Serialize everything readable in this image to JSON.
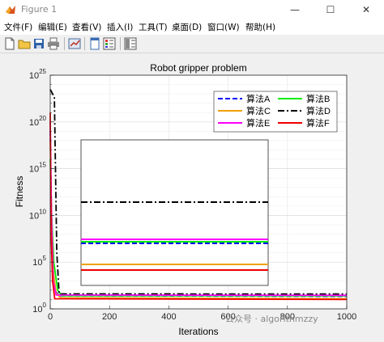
{
  "window": {
    "title": "Figure 1",
    "minimize": "—",
    "maximize": "☐",
    "close": "✕"
  },
  "menu": [
    "文件(F)",
    "编辑(E)",
    "查看(V)",
    "插入(I)",
    "工具(T)",
    "桌面(D)",
    "窗口(W)",
    "帮助(H)"
  ],
  "toolbar": [
    "new-figure-icon",
    "open-file-icon",
    "save-icon",
    "print-icon",
    "link-plot-icon",
    "dock-figure-icon",
    "insert-colorbar-icon",
    "insert-legend-icon"
  ],
  "watermark": "公众号 · algorithmzzy",
  "chart_data": {
    "type": "line",
    "title": "Robot gripper problem",
    "xlabel": "Iterations",
    "ylabel": "Fitness",
    "xlim": [
      0,
      1000
    ],
    "ylim": [
      1,
      1e+25
    ],
    "yscale": "log",
    "xticks": [
      "0",
      "200",
      "400",
      "600",
      "800",
      "1000"
    ],
    "yticks": [
      {
        "base": "10",
        "exp": "0",
        "v": 0
      },
      {
        "base": "10",
        "exp": "5",
        "v": 5
      },
      {
        "base": "10",
        "exp": "10",
        "v": 10
      },
      {
        "base": "10",
        "exp": "15",
        "v": 15
      },
      {
        "base": "10",
        "exp": "20",
        "v": 20
      },
      {
        "base": "10",
        "exp": "25",
        "v": 25
      }
    ],
    "grid": true,
    "legend_position": "top-right",
    "series": [
      {
        "name": "算法A",
        "color": "#0000ff",
        "dash": "6,3",
        "x": [
          0,
          3,
          8,
          15,
          30,
          1000
        ],
        "y": [
          1e+19,
          1000000000000.0,
          100000.0,
          100.0,
          25,
          22
        ]
      },
      {
        "name": "算法B",
        "color": "#00ee00",
        "dash": "",
        "x": [
          0,
          5,
          12,
          25,
          40,
          1000
        ],
        "y": [
          1e+16,
          10000000000.0,
          100000.0,
          100.0,
          25,
          24
        ]
      },
      {
        "name": "算法C",
        "color": "#f0a000",
        "dash": "",
        "x": [
          0,
          4,
          10,
          20,
          35,
          1000
        ],
        "y": [
          1e+18,
          10000000000.0,
          10000.0,
          50,
          15,
          12
        ]
      },
      {
        "name": "算法D",
        "color": "#000000",
        "dash": "8,3,2,3",
        "x": [
          0,
          8,
          14,
          22,
          30,
          1000
        ],
        "y": [
          3e+23,
          1e+23,
          5e+22,
          1000000.0,
          40,
          38
        ]
      },
      {
        "name": "算法E",
        "color": "#ff00ff",
        "dash": "",
        "x": [
          0,
          4,
          10,
          20,
          1000
        ],
        "y": [
          1e+20,
          10000000000.0,
          1000.0,
          30,
          28
        ]
      },
      {
        "name": "算法F",
        "color": "#ee0000",
        "dash": "",
        "x": [
          0,
          3,
          8,
          15,
          1000
        ],
        "y": [
          1e+21,
          100000000.0,
          1000.0,
          12,
          10
        ]
      }
    ]
  }
}
